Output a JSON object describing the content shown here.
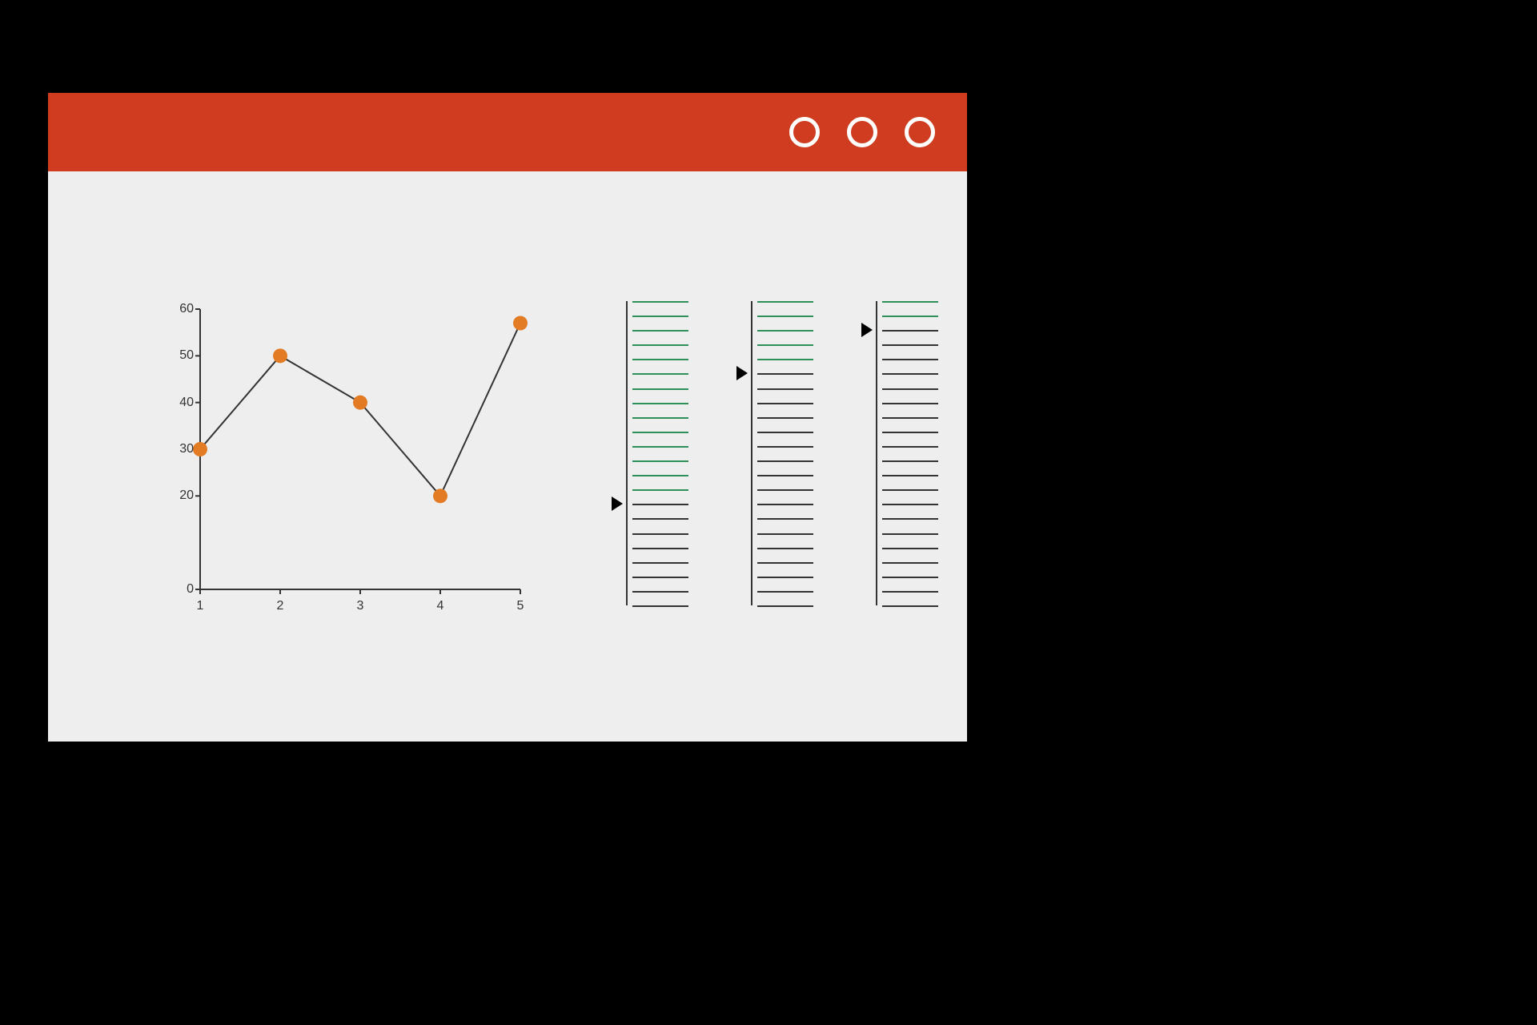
{
  "colors": {
    "accent": "#cf3c1f",
    "point": "#e37b24",
    "slider_green": "#2f8f5b"
  },
  "window": {
    "controls": [
      "circle",
      "circle",
      "circle"
    ]
  },
  "chart_data": {
    "type": "line",
    "categories": [
      "1",
      "2",
      "3",
      "4",
      "5"
    ],
    "values": [
      30,
      50,
      40,
      20,
      57
    ],
    "y_ticks": [
      0,
      20,
      30,
      40,
      50,
      60
    ],
    "ylim": [
      0,
      60
    ],
    "title": "",
    "xlabel": "",
    "ylabel": ""
  },
  "sliders": [
    {
      "ticks_total": 22,
      "threshold_green_top": 14,
      "thumb_index": 14
    },
    {
      "ticks_total": 22,
      "threshold_green_top": 5,
      "thumb_index": 5
    },
    {
      "ticks_total": 22,
      "threshold_green_top": 2,
      "thumb_index": 2
    }
  ]
}
